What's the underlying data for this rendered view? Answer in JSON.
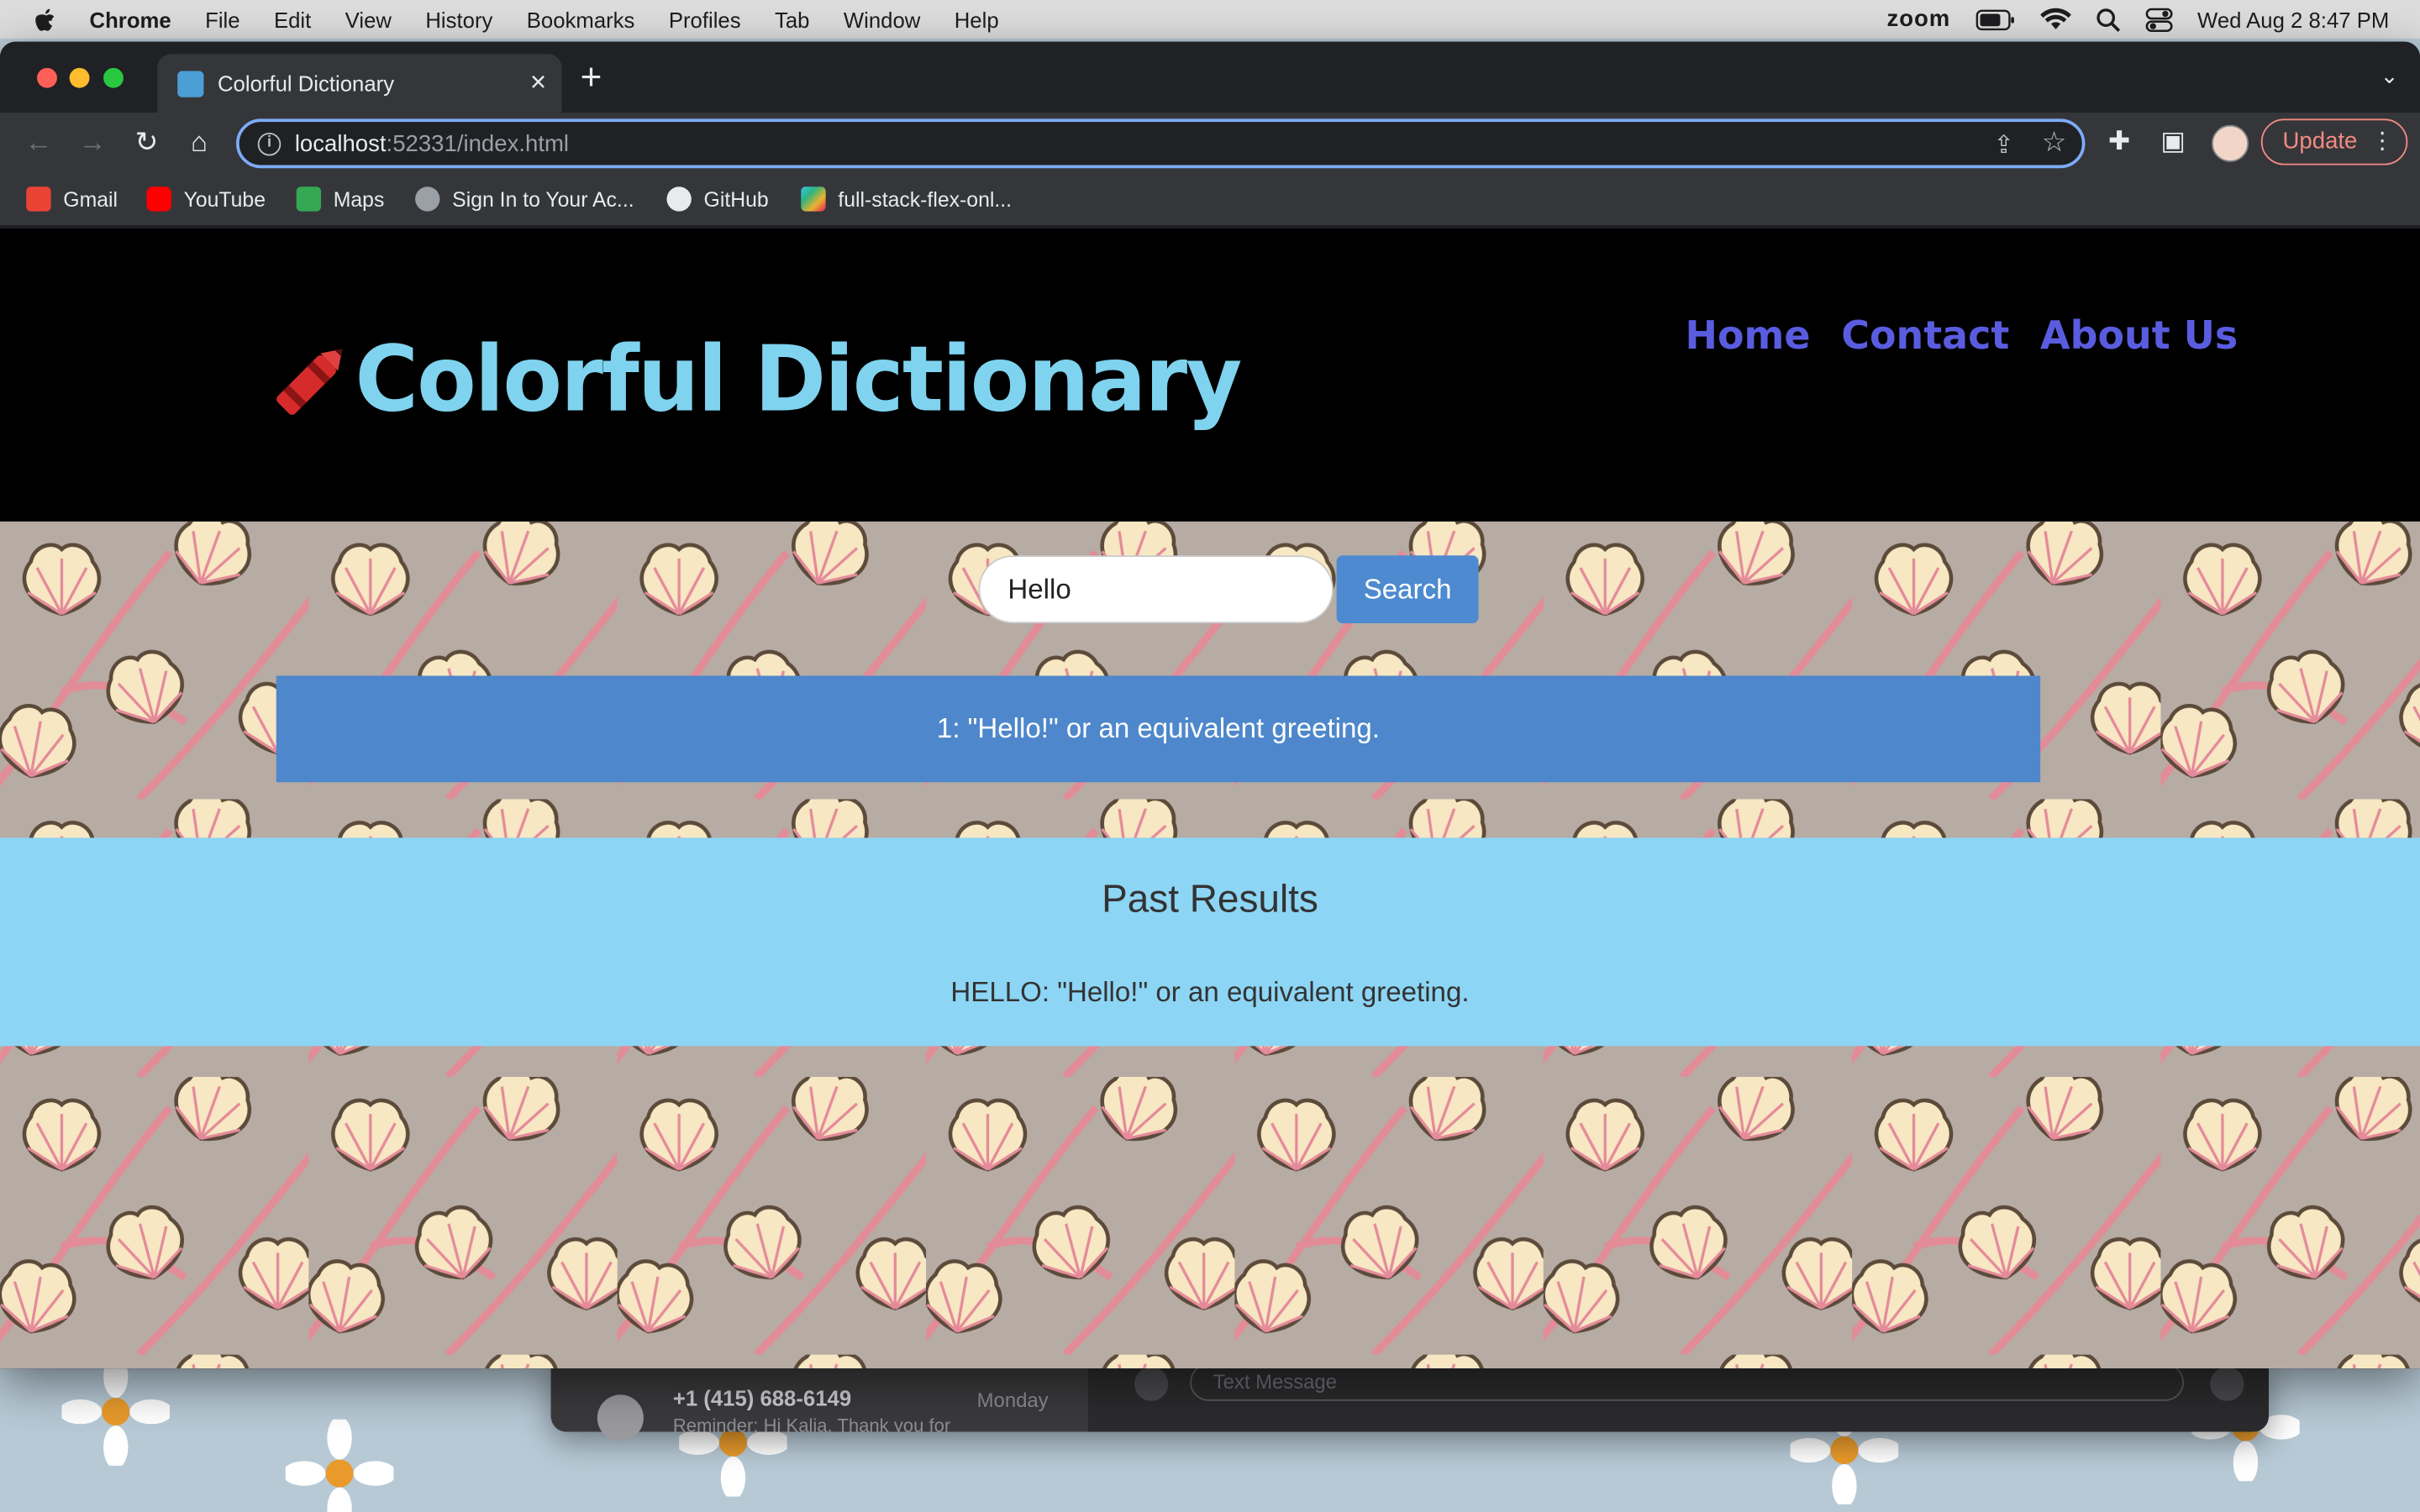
{
  "menubar": {
    "app_name": "Chrome",
    "items": [
      "File",
      "Edit",
      "View",
      "History",
      "Bookmarks",
      "Profiles",
      "Tab",
      "Window",
      "Help"
    ],
    "zoom_label": "zoom",
    "datetime": "Wed Aug 2  8:47 PM"
  },
  "browser": {
    "tab_title": "Colorful Dictionary",
    "url_host": "localhost",
    "url_rest": ":52331/index.html",
    "update_label": "Update",
    "bookmarks": [
      "Gmail",
      "YouTube",
      "Maps",
      "Sign In to Your Ac...",
      "GitHub",
      "full-stack-flex-onl..."
    ]
  },
  "site": {
    "logo_title": "Colorful Dictionary",
    "nav": [
      "Home",
      "Contact",
      "About Us"
    ],
    "search_value": "Hello",
    "search_button": "Search",
    "result": "1: \"Hello!\" or an equivalent greeting.",
    "past_results_heading": "Past Results",
    "past_results": [
      "HELLO: \"Hello!\" or an equivalent greeting."
    ]
  },
  "background_app": {
    "contact": "+1 (415) 688-6149",
    "day": "Monday",
    "preview": "Reminder: Hi Kalia, Thank you for",
    "input_placeholder": "Text Message"
  },
  "colors": {
    "header_bg": "#000000",
    "logo_text": "#7fd3ee",
    "nav_link": "#5a5ce0",
    "search_button": "#4e8ad0",
    "result_bg": "#4e87cb",
    "past_results_bg": "#8dd5f4",
    "pattern_bg": "#b6aca4"
  }
}
